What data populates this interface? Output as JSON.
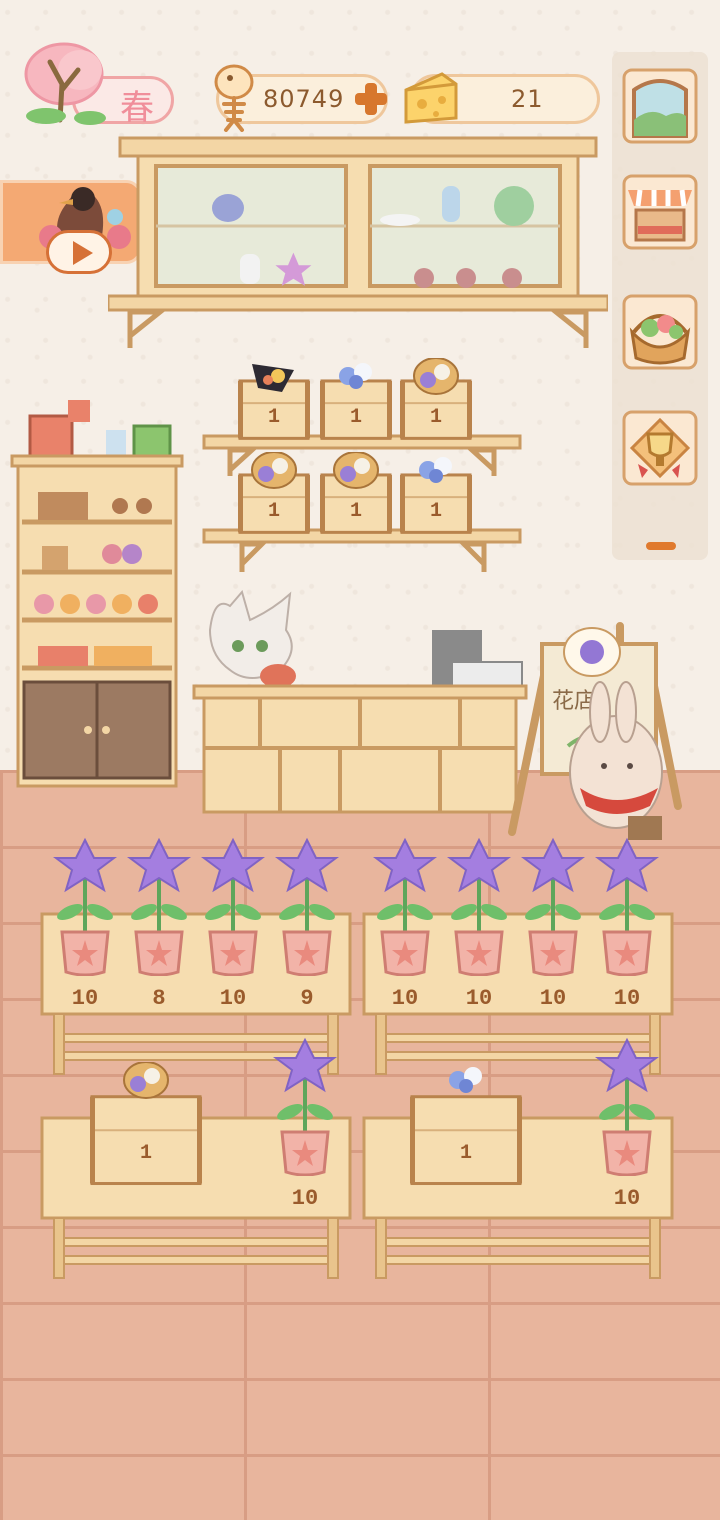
{
  "hud": {
    "season_label": "春",
    "fish_bones": "80749",
    "cheese": "21"
  },
  "shelf_crates": [
    {
      "count": "1",
      "item": "black-bouquet"
    },
    {
      "count": "1",
      "item": "blue-white-bouquet"
    },
    {
      "count": "1",
      "item": "flower-basket"
    },
    {
      "count": "1",
      "item": "flower-basket"
    },
    {
      "count": "1",
      "item": "flower-basket"
    },
    {
      "count": "1",
      "item": "blue-white-bouquet"
    }
  ],
  "table_pots_top_left": [
    "10",
    "8",
    "10",
    "9"
  ],
  "table_pots_top_right": [
    "10",
    "10",
    "10",
    "10"
  ],
  "bottom_left": {
    "crate_count": "1",
    "pot_count": "10"
  },
  "bottom_right": {
    "crate_count": "1",
    "pot_count": "10"
  },
  "colors": {
    "accent_orange": "#d7772d",
    "wood": "#f4d8a8",
    "wood_dark": "#c99a62",
    "flower_purple": "#a47ee0",
    "pot_pink": "#f2b3a8"
  }
}
